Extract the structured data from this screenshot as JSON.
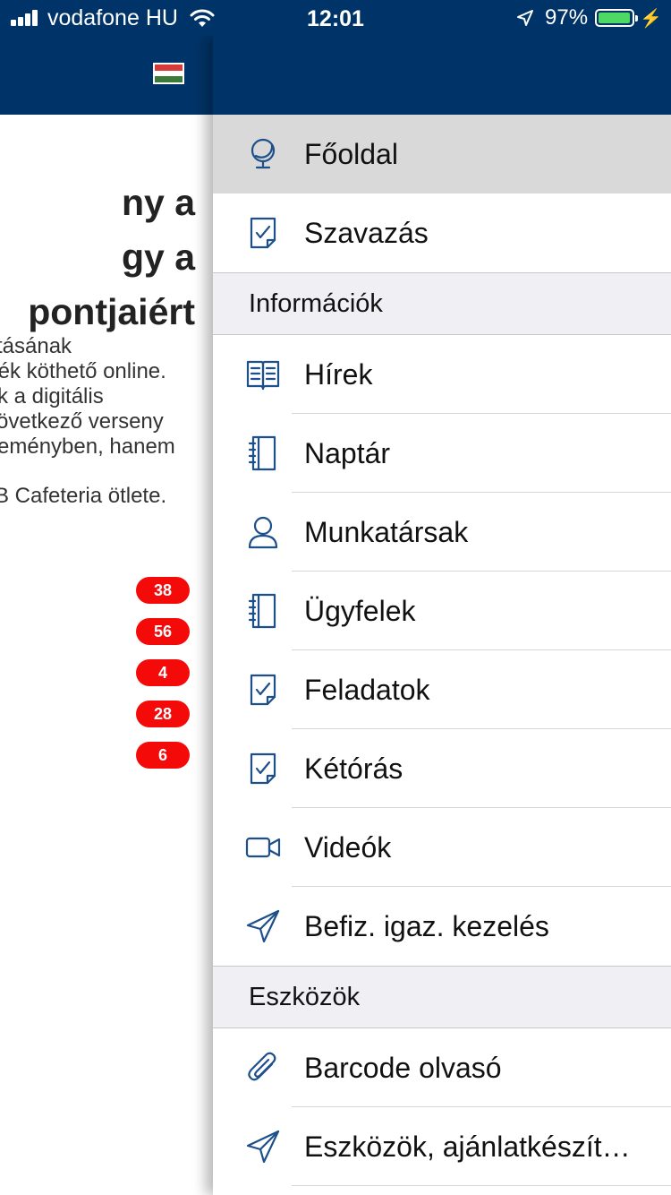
{
  "status_bar": {
    "carrier": "vodafone HU",
    "time": "12:01",
    "battery": "97%",
    "battery_level": 0.97
  },
  "background": {
    "headline": [
      "ny a",
      "gy a",
      "pontjaiért"
    ],
    "lead": [
      "tásának",
      "ték köthető online.",
      "k a digitális",
      "övetkező verseny",
      "eményben, hanem"
    ],
    "lead2": "B Cafeteria ötlete.",
    "badges": [
      "38",
      "56",
      "4",
      "28",
      "6"
    ]
  },
  "drawer": {
    "items": [
      {
        "label": "Főoldal",
        "icon": "globe-icon"
      },
      {
        "label": "Szavazás",
        "icon": "checked-document-icon"
      }
    ],
    "sections": [
      {
        "title": "Információk",
        "items": [
          {
            "label": "Hírek",
            "icon": "open-book-icon"
          },
          {
            "label": "Naptár",
            "icon": "notebook-icon"
          },
          {
            "label": "Munkatársak",
            "icon": "person-icon"
          },
          {
            "label": "Ügyfelek",
            "icon": "notebook-icon"
          },
          {
            "label": "Feladatok",
            "icon": "checked-document-icon"
          },
          {
            "label": "Kétórás",
            "icon": "checked-document-icon"
          },
          {
            "label": "Videók",
            "icon": "video-camera-icon"
          },
          {
            "label": "Befiz. igaz. kezelés",
            "icon": "paper-plane-icon"
          }
        ]
      },
      {
        "title": "Eszközök",
        "items": [
          {
            "label": "Barcode olvasó",
            "icon": "paperclip-icon"
          },
          {
            "label": "Eszközök, ajánlatkészít…",
            "icon": "paper-plane-icon"
          }
        ]
      }
    ]
  }
}
